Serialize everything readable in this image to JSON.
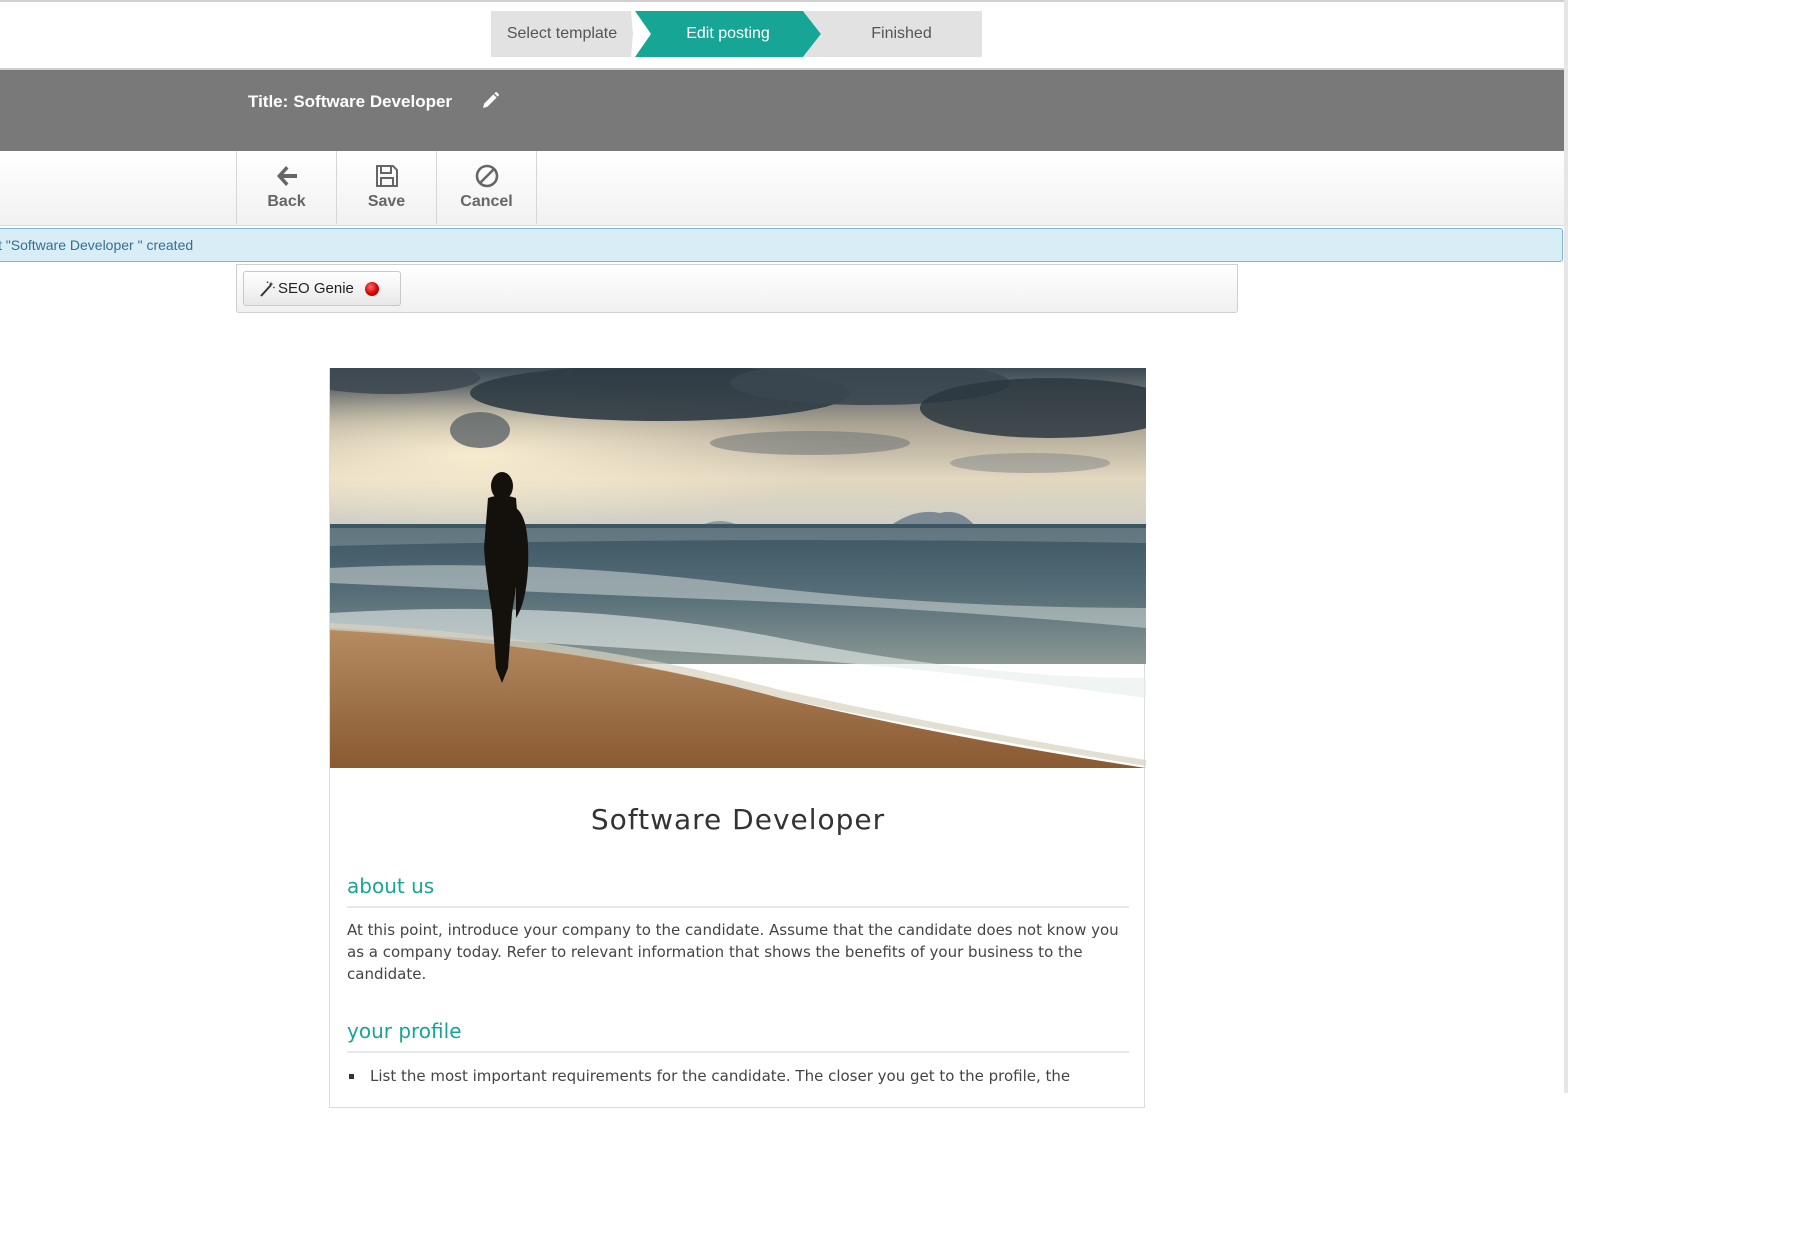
{
  "wizard": {
    "steps": [
      {
        "label": "Select template",
        "state": "done"
      },
      {
        "label": "Edit posting",
        "state": "active"
      },
      {
        "label": "Finished",
        "state": "pending"
      }
    ]
  },
  "header": {
    "title_label": "Title:",
    "title_value": "Software Developer"
  },
  "toolbar": {
    "back_label": "Back",
    "save_label": "Save",
    "cancel_label": "Cancel"
  },
  "alert": {
    "message": "t \"Software Developer \" created"
  },
  "seo": {
    "button_label": "SEO Genie",
    "status_color": "#d40000"
  },
  "posting": {
    "job_title": "Software Developer",
    "about_heading": "about us",
    "about_text": "At this point, introduce your company to the candidate. Assume that the candidate does not know you as a company today. Refer to relevant information that shows the benefits of your business to the candidate.",
    "profile_heading": "your profile",
    "profile_items": [
      "List the most important requirements for the candidate. The closer you get to the profile, the"
    ]
  },
  "colors": {
    "accent": "#17a596",
    "title_bar": "#797979",
    "alert_bg": "#d9edf7",
    "alert_text": "#31708f"
  }
}
